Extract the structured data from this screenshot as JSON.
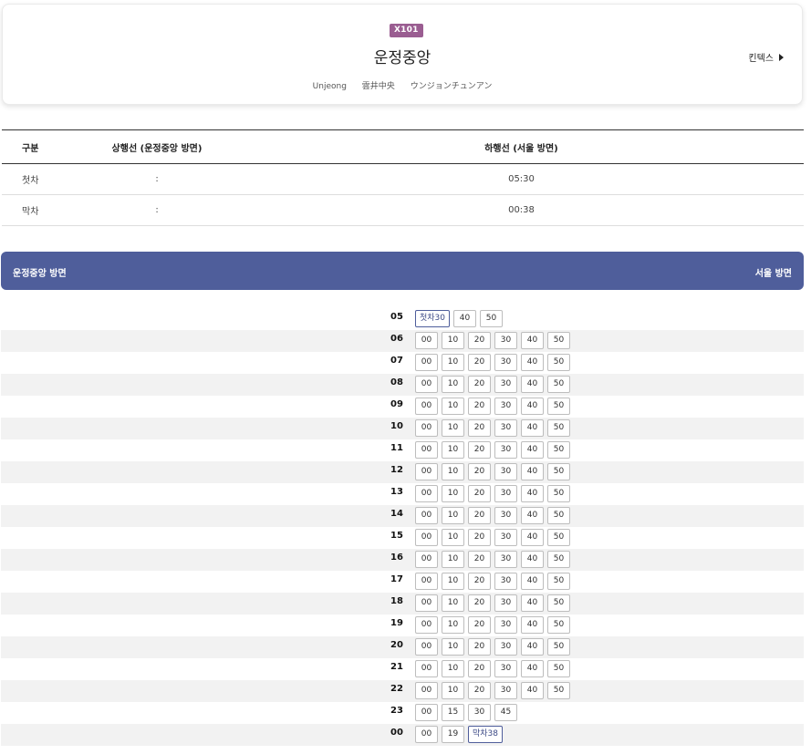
{
  "station": {
    "line_code": "X101",
    "name": "운정중앙",
    "alt_names": [
      "Unjeong",
      "雲井中央",
      "ウンジョンチュンアン"
    ],
    "next_station": "킨텍스",
    "next_icon": "triangle-right-icon"
  },
  "first_last": {
    "headers": [
      "구분",
      "상행선 (운정중앙 방면)",
      "하행선 (서울 방면)"
    ],
    "rows": [
      {
        "label": "첫차",
        "up": ":",
        "down": "05:30"
      },
      {
        "label": "막차",
        "up": ":",
        "down": "00:38"
      }
    ]
  },
  "direction": {
    "left": "운정중앙 방면",
    "right": "서울 방면",
    "color": "#4f5e9b"
  },
  "timetable": [
    {
      "hour": "05",
      "minutes": [
        "첫차30",
        "40",
        "50"
      ]
    },
    {
      "hour": "06",
      "minutes": [
        "00",
        "10",
        "20",
        "30",
        "40",
        "50"
      ]
    },
    {
      "hour": "07",
      "minutes": [
        "00",
        "10",
        "20",
        "30",
        "40",
        "50"
      ]
    },
    {
      "hour": "08",
      "minutes": [
        "00",
        "10",
        "20",
        "30",
        "40",
        "50"
      ]
    },
    {
      "hour": "09",
      "minutes": [
        "00",
        "10",
        "20",
        "30",
        "40",
        "50"
      ]
    },
    {
      "hour": "10",
      "minutes": [
        "00",
        "10",
        "20",
        "30",
        "40",
        "50"
      ]
    },
    {
      "hour": "11",
      "minutes": [
        "00",
        "10",
        "20",
        "30",
        "40",
        "50"
      ]
    },
    {
      "hour": "12",
      "minutes": [
        "00",
        "10",
        "20",
        "30",
        "40",
        "50"
      ]
    },
    {
      "hour": "13",
      "minutes": [
        "00",
        "10",
        "20",
        "30",
        "40",
        "50"
      ]
    },
    {
      "hour": "14",
      "minutes": [
        "00",
        "10",
        "20",
        "30",
        "40",
        "50"
      ]
    },
    {
      "hour": "15",
      "minutes": [
        "00",
        "10",
        "20",
        "30",
        "40",
        "50"
      ]
    },
    {
      "hour": "16",
      "minutes": [
        "00",
        "10",
        "20",
        "30",
        "40",
        "50"
      ]
    },
    {
      "hour": "17",
      "minutes": [
        "00",
        "10",
        "20",
        "30",
        "40",
        "50"
      ]
    },
    {
      "hour": "18",
      "minutes": [
        "00",
        "10",
        "20",
        "30",
        "40",
        "50"
      ]
    },
    {
      "hour": "19",
      "minutes": [
        "00",
        "10",
        "20",
        "30",
        "40",
        "50"
      ]
    },
    {
      "hour": "20",
      "minutes": [
        "00",
        "10",
        "20",
        "30",
        "40",
        "50"
      ]
    },
    {
      "hour": "21",
      "minutes": [
        "00",
        "10",
        "20",
        "30",
        "40",
        "50"
      ]
    },
    {
      "hour": "22",
      "minutes": [
        "00",
        "10",
        "20",
        "30",
        "40",
        "50"
      ]
    },
    {
      "hour": "23",
      "minutes": [
        "00",
        "15",
        "30",
        "45"
      ]
    },
    {
      "hour": "00",
      "minutes": [
        "00",
        "19",
        "막차38"
      ]
    }
  ]
}
